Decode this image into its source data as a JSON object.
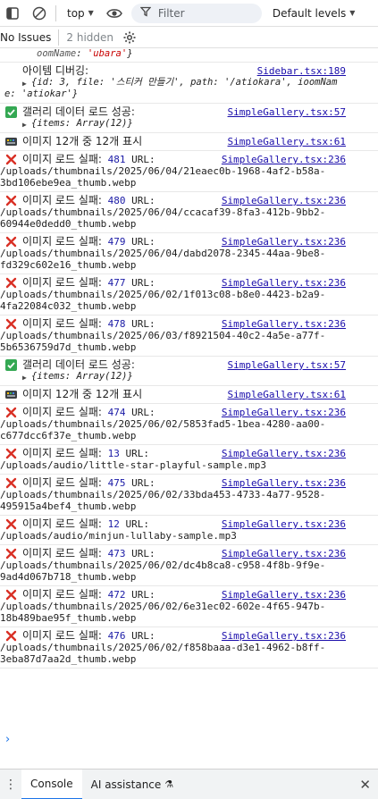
{
  "toolbar": {
    "context_label": "top",
    "filter_placeholder": "Filter",
    "levels_label": "Default levels"
  },
  "issues_bar": {
    "issues_label": "No Issues",
    "hidden_label": "2 hidden"
  },
  "console": {
    "top_fragment": {
      "key": "oomName",
      "value": "'ubara'"
    },
    "messages": [
      {
        "type": "log",
        "text": "아이템 디버깅:",
        "source": "Sidebar.tsx:189",
        "object_line1": "{id: 3, file: '스티커 만들기', path: '/atiokara', ioomNam",
        "object_line2": "e: 'atiokar'}"
      },
      {
        "type": "success",
        "text": "갤러리 데이터 로드 성공:",
        "source": "SimpleGallery.tsx:57",
        "object_line1": "{items: Array(12)}"
      },
      {
        "type": "info",
        "text": "이미지 12개 중 12개 표시",
        "source": "SimpleGallery.tsx:61"
      },
      {
        "type": "error",
        "text": "이미지 로드 실패:",
        "num": "481",
        "url_label": "URL:",
        "source": "SimpleGallery.tsx:236",
        "url_line1": "/uploads/thumbnails/2025/06/04/21eaec0b-1968-4af2-b58a-",
        "url_line2": "3bd106ebe9ea_thumb.webp"
      },
      {
        "type": "error",
        "text": "이미지 로드 실패:",
        "num": "480",
        "url_label": "URL:",
        "source": "SimpleGallery.tsx:236",
        "url_line1": "/uploads/thumbnails/2025/06/04/ccacaf39-8fa3-412b-9bb2-",
        "url_line2": "60944e0dedd0_thumb.webp"
      },
      {
        "type": "error",
        "text": "이미지 로드 실패:",
        "num": "479",
        "url_label": "URL:",
        "source": "SimpleGallery.tsx:236",
        "url_line1": "/uploads/thumbnails/2025/06/04/dabd2078-2345-44aa-9be8-",
        "url_line2": "fd329c602e16_thumb.webp"
      },
      {
        "type": "error",
        "text": "이미지 로드 실패:",
        "num": "477",
        "url_label": "URL:",
        "source": "SimpleGallery.tsx:236",
        "url_line1": "/uploads/thumbnails/2025/06/02/1f013c08-b8e0-4423-b2a9-",
        "url_line2": "4fa22084c032_thumb.webp"
      },
      {
        "type": "error",
        "text": "이미지 로드 실패:",
        "num": "478",
        "url_label": "URL:",
        "source": "SimpleGallery.tsx:236",
        "url_line1": "/uploads/thumbnails/2025/06/03/f8921504-40c2-4a5e-a77f-",
        "url_line2": "5b6536759d7d_thumb.webp"
      },
      {
        "type": "success",
        "text": "갤러리 데이터 로드 성공:",
        "source": "SimpleGallery.tsx:57",
        "object_line1": "{items: Array(12)}"
      },
      {
        "type": "info",
        "text": "이미지 12개 중 12개 표시",
        "source": "SimpleGallery.tsx:61"
      },
      {
        "type": "error",
        "text": "이미지 로드 실패:",
        "num": "474",
        "url_label": "URL:",
        "source": "SimpleGallery.tsx:236",
        "url_line1": "/uploads/thumbnails/2025/06/02/5853fad5-1bea-4280-aa00-",
        "url_line2": "c677dcc6f37e_thumb.webp"
      },
      {
        "type": "error",
        "text": "이미지 로드 실패:",
        "num": "13",
        "url_label": "URL:",
        "source": "SimpleGallery.tsx:236",
        "url_line1": "/uploads/audio/little-star-playful-sample.mp3",
        "url_line2": ""
      },
      {
        "type": "error",
        "text": "이미지 로드 실패:",
        "num": "475",
        "url_label": "URL:",
        "source": "SimpleGallery.tsx:236",
        "url_line1": "/uploads/thumbnails/2025/06/02/33bda453-4733-4a77-9528-",
        "url_line2": "495915a4bef4_thumb.webp"
      },
      {
        "type": "error",
        "text": "이미지 로드 실패:",
        "num": "12",
        "url_label": "URL:",
        "source": "SimpleGallery.tsx:236",
        "url_line1": "/uploads/audio/minjun-lullaby-sample.mp3",
        "url_line2": ""
      },
      {
        "type": "error",
        "text": "이미지 로드 실패:",
        "num": "473",
        "url_label": "URL:",
        "source": "SimpleGallery.tsx:236",
        "url_line1": "/uploads/thumbnails/2025/06/02/dc4b8ca8-c958-4f8b-9f9e-",
        "url_line2": "9ad4d067b718_thumb.webp"
      },
      {
        "type": "error",
        "text": "이미지 로드 실패:",
        "num": "472",
        "url_label": "URL:",
        "source": "SimpleGallery.tsx:236",
        "url_line1": "/uploads/thumbnails/2025/06/02/6e31ec02-602e-4f65-947b-",
        "url_line2": "18b489bae95f_thumb.webp"
      },
      {
        "type": "error",
        "text": "이미지 로드 실패:",
        "num": "476",
        "url_label": "URL:",
        "source": "SimpleGallery.tsx:236",
        "url_line1": "/uploads/thumbnails/2025/06/02/f858baaa-d3e1-4962-b8ff-",
        "url_line2": "3eba87d7aa2d_thumb.webp"
      }
    ],
    "prompt_symbol": "›"
  },
  "drawer": {
    "tabs": [
      "Console",
      "AI assistance"
    ],
    "ai_icon": "flask-icon"
  },
  "colors": {
    "link": "#1a0dab",
    "error_x": "#d93025",
    "success": "#34a853",
    "accent": "#1a73e8"
  }
}
